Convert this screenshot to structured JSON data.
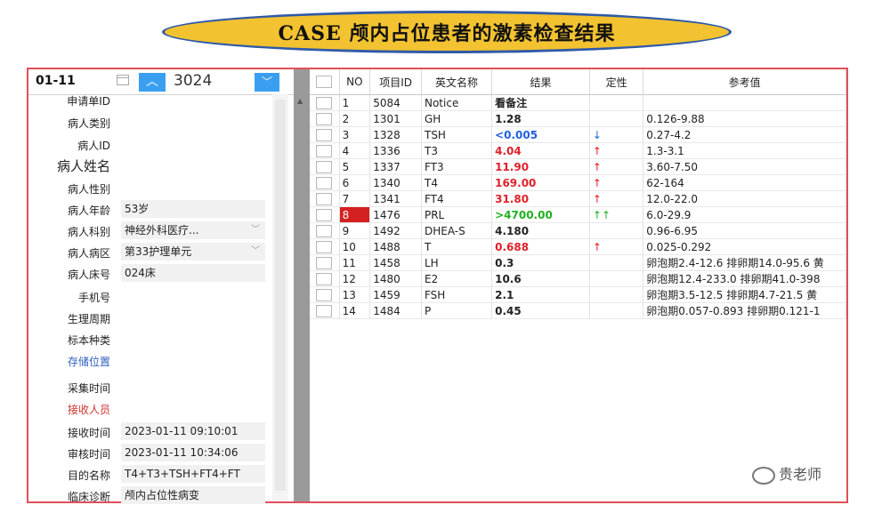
{
  "banner": {
    "title": "CASE  颅内占位患者的激素检查结果"
  },
  "left": {
    "date": "01-11",
    "number": "3024",
    "up_icon": "chevron-up-icon",
    "down_icon": "chevron-down-icon",
    "fields": [
      {
        "label": "申请单ID",
        "value": ""
      },
      {
        "label": "病人类别",
        "value": ""
      },
      {
        "label": "病人ID",
        "value": ""
      },
      {
        "label": "病人姓名",
        "value": ""
      },
      {
        "label": "病人性别",
        "value": ""
      },
      {
        "label": "病人年龄",
        "value": "53岁"
      },
      {
        "label": "病人科别",
        "value": "神经外科医疗..."
      },
      {
        "label": "病人病区",
        "value": "第33护理单元"
      },
      {
        "label": "病人床号",
        "value": "024床"
      },
      {
        "label": "手机号",
        "value": ""
      },
      {
        "label": "生理周期",
        "value": ""
      },
      {
        "label": "标本种类",
        "value": ""
      },
      {
        "label": "存储位置",
        "value": ""
      },
      {
        "label": "采集时间",
        "value": ""
      },
      {
        "label": "接收人员",
        "value": ""
      },
      {
        "label": "接收时间",
        "value": "2023-01-11 09:10:01"
      },
      {
        "label": "审核时间",
        "value": "2023-01-11 10:34:06"
      },
      {
        "label": "目的名称",
        "value": "T4+T3+TSH+FT4+FT"
      },
      {
        "label": "临床诊断",
        "value": "颅内占位性病变"
      }
    ]
  },
  "grid": {
    "headers": [
      "NO",
      "项目ID",
      "英文名称",
      "结果",
      "定性",
      "参考值"
    ],
    "rows": [
      {
        "no": "1",
        "id": "5084",
        "name": "Notice",
        "result": "看备注",
        "flag": "",
        "ref": ""
      },
      {
        "no": "2",
        "id": "1301",
        "name": "GH",
        "result": "1.28",
        "flag": "",
        "ref": "0.126-9.88"
      },
      {
        "no": "3",
        "id": "1328",
        "name": "TSH",
        "result": "<0.005",
        "flag": "↓",
        "ref": "0.27-4.2"
      },
      {
        "no": "4",
        "id": "1336",
        "name": "T3",
        "result": "4.04",
        "flag": "↑",
        "ref": "1.3-3.1"
      },
      {
        "no": "5",
        "id": "1337",
        "name": "FT3",
        "result": "11.90",
        "flag": "↑",
        "ref": "3.60-7.50"
      },
      {
        "no": "6",
        "id": "1340",
        "name": "T4",
        "result": "169.00",
        "flag": "↑",
        "ref": "62-164"
      },
      {
        "no": "7",
        "id": "1341",
        "name": "FT4",
        "result": "31.80",
        "flag": "↑",
        "ref": "12.0-22.0"
      },
      {
        "no": "8",
        "id": "1476",
        "name": "PRL",
        "result": ">4700.00",
        "flag": "↑↑",
        "ref": "6.0-29.9"
      },
      {
        "no": "9",
        "id": "1492",
        "name": "DHEA-S",
        "result": "4.180",
        "flag": "",
        "ref": "0.96-6.95"
      },
      {
        "no": "10",
        "id": "1488",
        "name": "T",
        "result": "0.688",
        "flag": "↑",
        "ref": "0.025-0.292"
      },
      {
        "no": "11",
        "id": "1458",
        "name": "LH",
        "result": "0.3",
        "flag": "",
        "ref": "卵泡期2.4-12.6 排卵期14.0-95.6 黄"
      },
      {
        "no": "12",
        "id": "1480",
        "name": "E2",
        "result": "10.6",
        "flag": "",
        "ref": "卵泡期12.4-233.0 排卵期41.0-398"
      },
      {
        "no": "13",
        "id": "1459",
        "name": "FSH",
        "result": "2.1",
        "flag": "",
        "ref": "卵泡期3.5-12.5 排卵期4.7-21.5 黄"
      },
      {
        "no": "14",
        "id": "1484",
        "name": "P",
        "result": "0.45",
        "flag": "",
        "ref": "卵泡期0.057-0.893 排卵期0.121-1"
      }
    ]
  },
  "watermark": {
    "text": "贵老师",
    "icon": "wechat-icon"
  },
  "colors": {
    "banner_fill": "#f2c230",
    "banner_border": "#2f5aa8",
    "frame": "#e0505a",
    "accent": "#3a9ff0",
    "high": "#e0202a",
    "low": "#2060e0",
    "very_high": "#20b020"
  }
}
